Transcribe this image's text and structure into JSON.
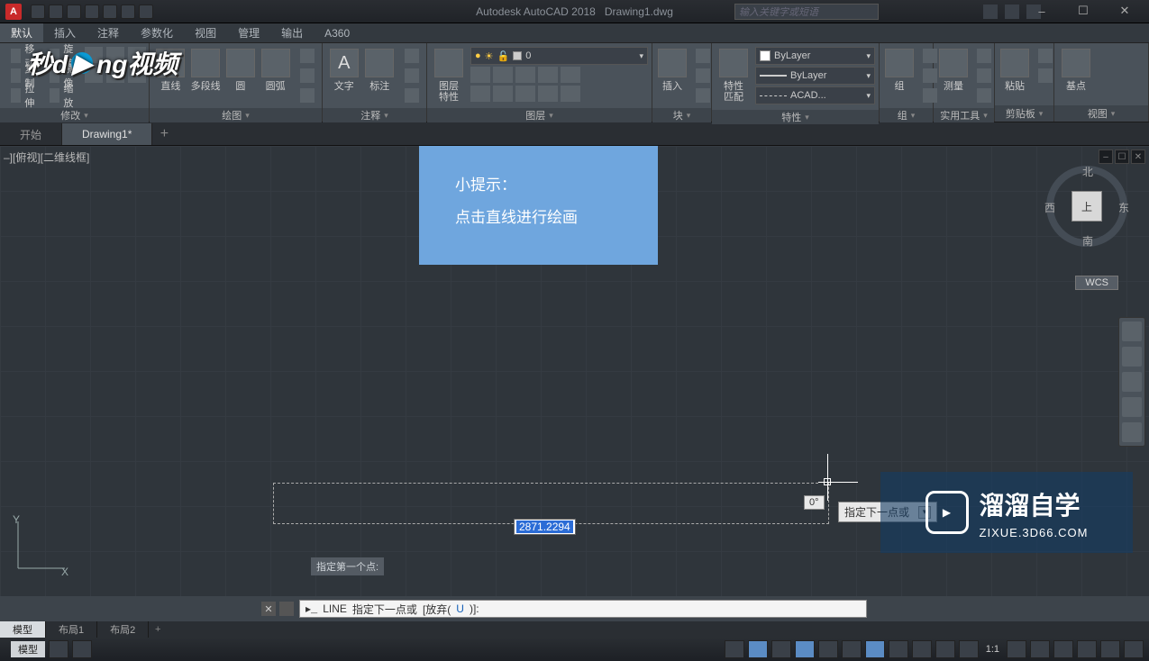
{
  "app": {
    "title_vendor": "Autodesk AutoCAD 2018",
    "title_file": "Drawing1.dwg"
  },
  "title_search_placeholder": "输入关键字或短语",
  "win": {
    "min": "–",
    "max": "☐",
    "close": "✕"
  },
  "menu": {
    "items": [
      "默认",
      "插入",
      "注释",
      "参数化",
      "视图",
      "管理",
      "输出",
      "A360"
    ],
    "active": 0
  },
  "ribbon": {
    "modify": {
      "title": "修改",
      "move": "移动",
      "copy": "复制",
      "stretch": "拉伸",
      "rotate": "旋转",
      "mirror": "镜像",
      "scale": "缩放"
    },
    "draw": {
      "title": "绘图",
      "line": "直线",
      "pline": "多段线",
      "circle": "圆",
      "arc": "圆弧"
    },
    "annot": {
      "title": "注释",
      "text": "文字",
      "dim": "标注"
    },
    "layer": {
      "title": "图层",
      "btn": "图层\n特性",
      "current": "0"
    },
    "block": {
      "title": "块",
      "insert": "插入"
    },
    "prop": {
      "title": "特性",
      "btn": "特性\n匹配",
      "bylayer": "ByLayer",
      "acad": "ACAD..."
    },
    "group": {
      "title": "组",
      "btn": "组"
    },
    "util": {
      "title": "实用工具",
      "btn": "测量"
    },
    "clip": {
      "title": "剪贴板",
      "btn": "粘贴"
    },
    "view": {
      "title": "视图",
      "btn": "基点"
    }
  },
  "filetabs": {
    "start": "开始",
    "file": "Drawing1*"
  },
  "viewport_label": "–][俯视][二维线框]",
  "hint": {
    "l1": "小提示：",
    "l2": "点击直线进行绘画"
  },
  "viewcube": {
    "top": "上",
    "n": "北",
    "s": "南",
    "e": "东",
    "w": "西"
  },
  "wcs": "WCS",
  "dyn": {
    "len": "2871.2294",
    "angle": "0°",
    "prompt": "指定下一点或"
  },
  "cmd_hist": "指定第一个点:",
  "cmd": {
    "cmd_name": "LINE",
    "prompt": "指定下一点或 ",
    "opt_pre": "[放弃(",
    "opt_u": "U",
    "opt_post": ")]:"
  },
  "model_tabs": {
    "model": "模型",
    "l1": "布局1",
    "l2": "布局2"
  },
  "status": {
    "model": "模型",
    "scale": "1:1"
  },
  "watermark_br": {
    "t1": "溜溜自学",
    "t2": "ZIXUE.3D66.COM"
  },
  "watermark_tl": "秒dong视频"
}
